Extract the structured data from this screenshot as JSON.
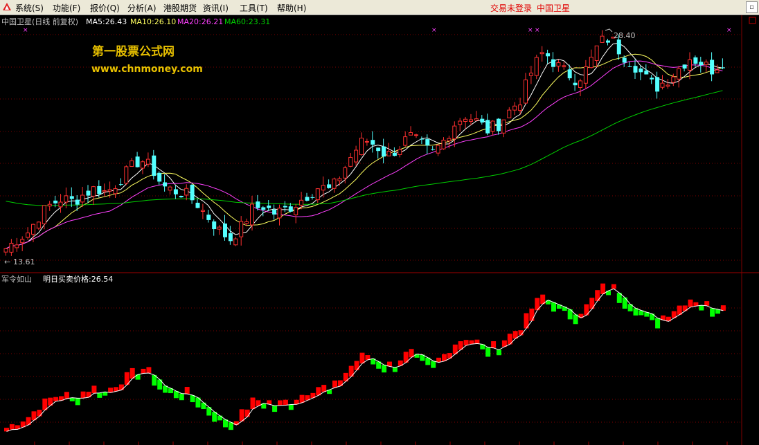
{
  "menubar": {
    "items": [
      {
        "label": "系统(S)"
      },
      {
        "label": "功能(F)"
      },
      {
        "label": "报价(Q)"
      },
      {
        "label": "分析(A)"
      },
      {
        "label": "港股期货"
      },
      {
        "label": "资讯(I)"
      },
      {
        "label": "工具(T)"
      },
      {
        "label": "帮助(H)"
      }
    ],
    "login_status": "交易未登录",
    "stock_title": "中国卫星"
  },
  "main_panel": {
    "header": {
      "stock": "中国卫星(日线 前复权)",
      "ma5": "MA5:26.43",
      "ma10": "MA10:26.10",
      "ma20": "MA20:26.21",
      "ma60": "MA60:23.31"
    },
    "watermark_title": "第一股票公式网",
    "watermark_url": "www.chnmoney.com",
    "high_label": "28.40",
    "low_label": "13.61",
    "colors": {
      "up": "#ff3030",
      "down": "#54ffff",
      "ma5": "#ffffff",
      "ma10": "#ffff60",
      "ma20": "#ff40ff",
      "ma60": "#00d000",
      "grid": "#800000"
    }
  },
  "sub_panel": {
    "indicator_name": "军令如山",
    "indicator_value": "明日买卖价格:26.54",
    "colors": {
      "up": "#ff0000",
      "down": "#00ff00",
      "line": "#ffffff"
    }
  },
  "chart_data": {
    "type": "candlestick",
    "series": [
      {
        "name": "MA5",
        "value": 26.43
      },
      {
        "name": "MA10",
        "value": 26.1
      },
      {
        "name": "MA20",
        "value": 26.21
      },
      {
        "name": "MA60",
        "value": 23.31
      }
    ],
    "price_range": [
      13.61,
      28.4
    ],
    "close_path": [
      14.2,
      14.8,
      15.3,
      16.4,
      17.1,
      17.5,
      17.3,
      17.8,
      18.2,
      17.9,
      18.6,
      19.4,
      20.1,
      19.5,
      18.3,
      18.0,
      17.8,
      17.2,
      16.3,
      15.4,
      14.8,
      15.6,
      16.8,
      17.0,
      16.5,
      16.8,
      17.2,
      17.8,
      18.3,
      18.0,
      19.2,
      20.5,
      21.4,
      21.0,
      20.3,
      20.8,
      21.6,
      21.1,
      20.4,
      21.2,
      22.4,
      23.0,
      22.6,
      22.0,
      22.4,
      23.3,
      24.1,
      26.0,
      27.2,
      26.4,
      25.8,
      25.3,
      26.2,
      27.8,
      28.1,
      27.0,
      26.4,
      25.5,
      24.8,
      25.3,
      26.0,
      26.8,
      26.5,
      26.0,
      26.54
    ],
    "indicator": {
      "name": "军令如山",
      "label": "明日买卖价格",
      "value": 26.54
    }
  }
}
